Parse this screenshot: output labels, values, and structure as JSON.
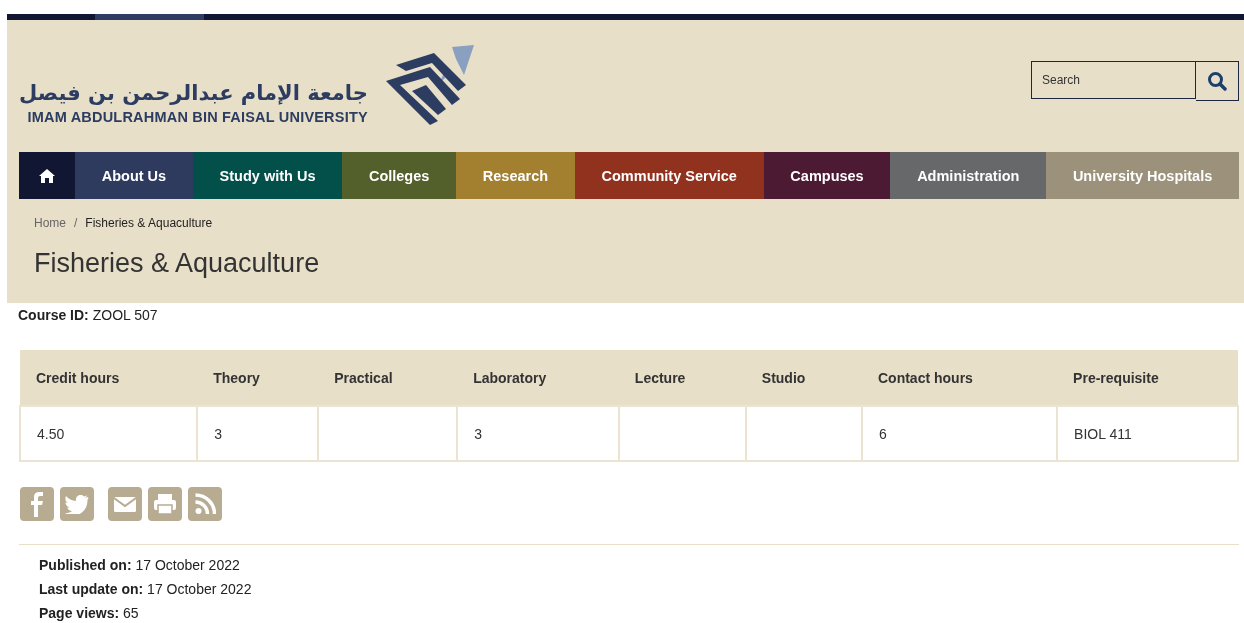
{
  "header": {
    "logo_arabic": "جامعة الإمام عبدالرحمن بن فيصل",
    "logo_english": "IMAM ABDULRAHMAN BIN FAISAL UNIVERSITY",
    "search": {
      "placeholder": "Search"
    }
  },
  "nav": [
    {
      "kind": "home",
      "color": "#111733"
    },
    {
      "kind": "link",
      "label": "About Us",
      "color": "#2f3b5e"
    },
    {
      "kind": "link",
      "label": "Study with Us",
      "color": "#03504b"
    },
    {
      "kind": "link",
      "label": "Colleges",
      "color": "#54602c"
    },
    {
      "kind": "link",
      "label": "Research",
      "color": "#a3802f"
    },
    {
      "kind": "link",
      "label": "Community Service",
      "color": "#91321f"
    },
    {
      "kind": "link",
      "label": "Campuses",
      "color": "#4d1a33"
    },
    {
      "kind": "link",
      "label": "Administration",
      "color": "#676869"
    },
    {
      "kind": "link",
      "label": "University Hospitals",
      "color": "#9c917b"
    }
  ],
  "breadcrumb": [
    "Home",
    "Fisheries & Aquaculture"
  ],
  "breadcrumb_separator": "/",
  "title": "Fisheries & Aquaculture",
  "course_id": {
    "label": "Course ID:",
    "value": "ZOOL 507"
  },
  "table": {
    "columns": [
      "Credit hours",
      "Theory",
      "Practical",
      "Laboratory",
      "Lecture",
      "Studio",
      "Contact hours",
      "Pre-requisite"
    ],
    "rows": [
      [
        "4.50",
        "3",
        null,
        "3",
        null,
        null,
        "6",
        "BIOL 411"
      ]
    ]
  },
  "share": [
    {
      "kind": "facebook"
    },
    {
      "kind": "twitter"
    },
    {
      "kind": "email"
    },
    {
      "kind": "print"
    },
    {
      "kind": "rss"
    }
  ],
  "meta": [
    {
      "label": "Published on:",
      "value": "17 October 2022"
    },
    {
      "label": "Last update on:",
      "value": "17 October 2022"
    },
    {
      "label": "Page views:",
      "value": "65"
    }
  ]
}
